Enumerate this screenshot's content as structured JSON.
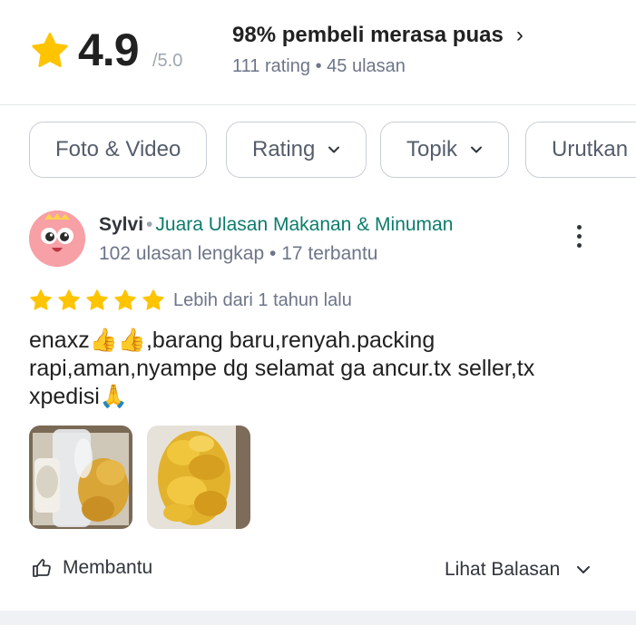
{
  "summary": {
    "score": "4.9",
    "score_max": "/5.0",
    "satisfaction": "98% pembeli merasa puas",
    "rating_count": "111 rating",
    "separator": "•",
    "review_count": "45 ulasan",
    "star_color": "#ffc400"
  },
  "filters": [
    {
      "label": "Foto & Video",
      "has_chevron": false
    },
    {
      "label": "Rating",
      "has_chevron": true
    },
    {
      "label": "Topik",
      "has_chevron": true
    },
    {
      "label": "Urutkan",
      "has_chevron": false
    }
  ],
  "review": {
    "name": "Sylvi",
    "badge": "Juara Ulasan Makanan & Minuman",
    "reviews_full": "102 ulasan lengkap",
    "helped": "17 terbantu",
    "rating": 5,
    "rating_max": 5,
    "time": "Lebih dari 1 tahun lalu",
    "text": "enaxz👍👍,barang baru,renyah.packing rapi,aman,nyampe dg selamat ga ancur.tx seller,tx xpedisi🙏",
    "photos": [
      "photo-1",
      "photo-2"
    ],
    "helpful_label": "Membantu",
    "replies_label": "Lihat Balasan"
  },
  "icons": {
    "star": "star-icon",
    "more": "more-vertical-icon",
    "thumb": "thumbs-up-icon",
    "chevron": "chevron-down-icon"
  },
  "colors": {
    "badge": "#0c7c6b",
    "muted": "#6d7588",
    "chip_border": "#c9ced6"
  }
}
